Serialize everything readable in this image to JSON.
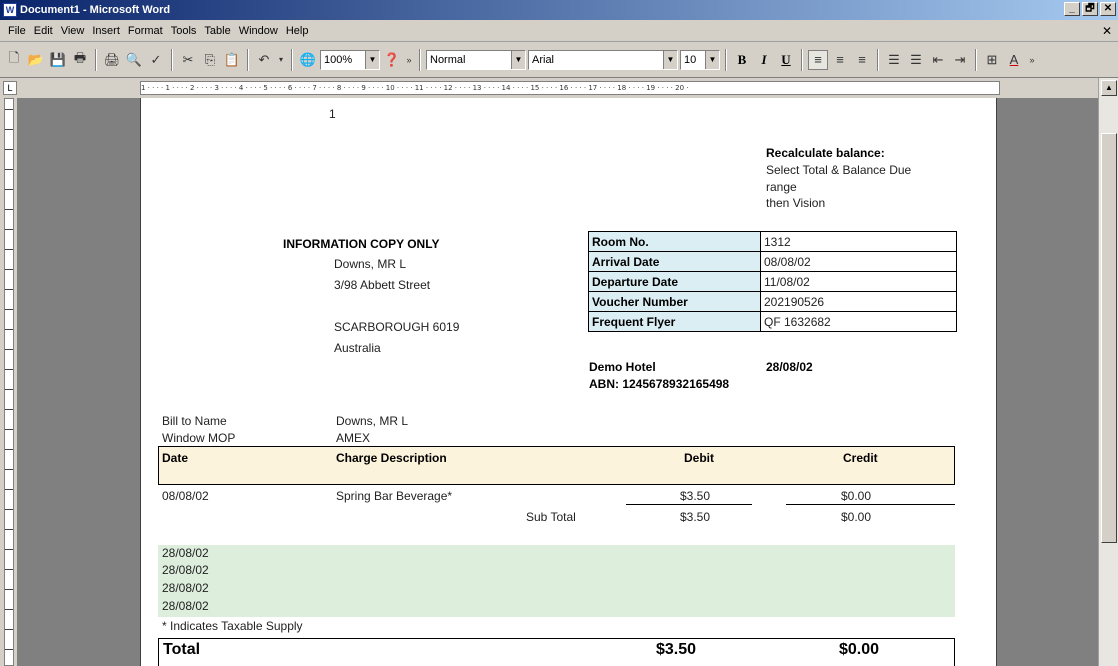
{
  "window": {
    "title": "Document1 - Microsoft Word",
    "app_icon": "W",
    "minimize": "_",
    "restore": "🗗",
    "close": "✕"
  },
  "menu": [
    "File",
    "Edit",
    "View",
    "Insert",
    "Format",
    "Tools",
    "Table",
    "Window",
    "Help"
  ],
  "toolbar": {
    "zoom": "100%",
    "style": "Normal",
    "font": "Arial",
    "size": "10",
    "bold": "B",
    "italic": "I",
    "underline": "U"
  },
  "ruler": {
    "text": "1 · · · · 1 · · · · 2 · · · · 3 · · · · 4 · · · · 5 · · · · 6 · · · · 7 · · · · 8 · · · · 9 · · · · 10 · · · · 11 · · · · 12 · · · · 13 · · · · 14 · · · · 15 · · · · 16 · · · · 17 · · · · 18 · · · · 19 · · · · 20 ·",
    "page_number": "1"
  },
  "note": {
    "title": "Recalculate balance:",
    "line1": "Select Total & Balance Due",
    "line2": "range",
    "line3": "then Vision"
  },
  "guest": {
    "heading": "INFORMATION COPY ONLY",
    "name": "Downs, MR L",
    "street": "3/98 Abbett Street",
    "city": "SCARBOROUGH  6019",
    "country": "Australia"
  },
  "room_table": [
    {
      "label": "Room No.",
      "value": "1312"
    },
    {
      "label": "Arrival Date",
      "value": "08/08/02"
    },
    {
      "label": "Departure Date",
      "value": "11/08/02"
    },
    {
      "label": "Voucher Number",
      "value": "202190526"
    },
    {
      "label": "Frequent Flyer",
      "value": "QF 1632682"
    }
  ],
  "hotel": {
    "name": "Demo Hotel",
    "date": "28/08/02",
    "abn": "ABN: 1245678932165498"
  },
  "billing": {
    "bill_to_label": "Bill to Name",
    "bill_to_value": "Downs, MR L",
    "mop_label": "Window MOP",
    "mop_value": "AMEX"
  },
  "charges_header": {
    "date": "Date",
    "description": "Charge Description",
    "debit": "Debit",
    "credit": "Credit"
  },
  "charges": [
    {
      "date": "08/08/02",
      "description": "Spring Bar Beverage*",
      "debit": "$3.50",
      "credit": "$0.00"
    }
  ],
  "subtotal": {
    "label": "Sub Total",
    "debit": "$3.50",
    "credit": "$0.00"
  },
  "green_dates": [
    "28/08/02",
    "28/08/02",
    "28/08/02",
    "28/08/02"
  ],
  "footnote": "* Indicates Taxable Supply",
  "total": {
    "label": "Total",
    "debit": "$3.50",
    "credit": "$0.00"
  }
}
